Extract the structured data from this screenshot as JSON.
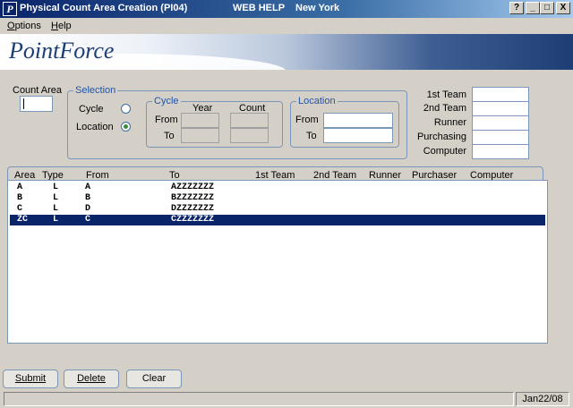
{
  "titlebar": {
    "title": "Physical Count Area Creation (PI04)",
    "web_help": "WEB HELP",
    "location": "New York",
    "help_btn": "?",
    "min_btn": "_",
    "max_btn": "□",
    "close_btn": "X"
  },
  "menu": {
    "options": "Options",
    "help": "Help"
  },
  "banner": {
    "logo_part1": "Point",
    "logo_part2": "Force"
  },
  "count_area": {
    "label": "Count Area",
    "value": ""
  },
  "selection": {
    "legend": "Selection",
    "cycle_label": "Cycle",
    "location_label": "Location",
    "selected": "Location",
    "cycle_box": {
      "legend": "Cycle",
      "year_header": "Year",
      "count_header": "Count",
      "from_label": "From",
      "to_label": "To"
    },
    "location_box": {
      "legend": "Location",
      "from_label": "From",
      "to_label": "To",
      "from_value": "",
      "to_value": ""
    }
  },
  "staff": {
    "first_team": "1st Team",
    "second_team": "2nd Team",
    "runner": "Runner",
    "purchasing": "Purchasing",
    "computer": "Computer"
  },
  "table": {
    "columns": [
      "Area",
      "Type",
      "From",
      "To",
      "1st Team",
      "2nd Team",
      "Runner",
      "Purchaser",
      "Computer"
    ],
    "rows": [
      {
        "area": "A",
        "type": "L",
        "from": "A",
        "to": "AZZZZZZZ",
        "selected": false
      },
      {
        "area": "B",
        "type": "L",
        "from": "B",
        "to": "BZZZZZZZ",
        "selected": false
      },
      {
        "area": "C",
        "type": "L",
        "from": "D",
        "to": "DZZZZZZZ",
        "selected": false
      },
      {
        "area": "ZC",
        "type": "L",
        "from": "C",
        "to": "CZZZZZZZ",
        "selected": true
      }
    ]
  },
  "buttons": {
    "submit": "Submit",
    "delete": "Delete",
    "clear": "Clear"
  },
  "status": {
    "date": "Jan22/08"
  },
  "colors": {
    "title_dark": "#0a246a",
    "accent_blue": "#2353a4",
    "face": "#d4d0c8"
  }
}
